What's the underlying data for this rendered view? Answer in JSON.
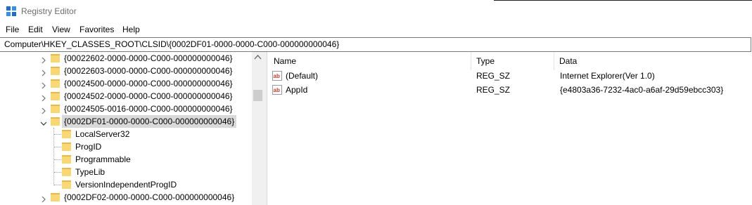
{
  "window": {
    "title": "Registry Editor"
  },
  "menu": {
    "items": [
      "File",
      "Edit",
      "View",
      "Favorites",
      "Help"
    ]
  },
  "address": {
    "value": "Computer\\HKEY_CLASSES_ROOT\\CLSID\\{0002DF01-0000-0000-C000-000000000046}"
  },
  "tree": {
    "nodes": [
      {
        "label": "{00022602-0000-0000-C000-000000000046}",
        "expanded": false
      },
      {
        "label": "{00022603-0000-0000-C000-000000000046}",
        "expanded": false
      },
      {
        "label": "{00024500-0000-0000-C000-000000000046}",
        "expanded": false
      },
      {
        "label": "{00024502-0000-0000-C000-000000000046}",
        "expanded": false
      },
      {
        "label": "{00024505-0016-0000-C000-000000000046}",
        "expanded": false
      },
      {
        "label": "{0002DF01-0000-0000-C000-000000000046}",
        "expanded": true,
        "selected": true
      },
      {
        "label": "{0002DF02-0000-0000-C000-000000000046}",
        "expanded": false
      }
    ],
    "children": [
      {
        "label": "LocalServer32"
      },
      {
        "label": "ProgID"
      },
      {
        "label": "Programmable"
      },
      {
        "label": "TypeLib"
      },
      {
        "label": "VersionIndependentProgID"
      }
    ]
  },
  "values": {
    "columns": {
      "name": "Name",
      "type": "Type",
      "data": "Data"
    },
    "rows": [
      {
        "name": "(Default)",
        "type": "REG_SZ",
        "data": "Internet Explorer(Ver 1.0)",
        "icon": "string-value-icon"
      },
      {
        "name": "AppId",
        "type": "REG_SZ",
        "data": "{e4803a36-7232-4ac0-a6af-29d59ebcc303}",
        "icon": "string-value-icon"
      }
    ]
  },
  "colors": {
    "selection": "#d9d9d9",
    "folder": "#f8d775",
    "title_text": "#6d6d6d"
  }
}
